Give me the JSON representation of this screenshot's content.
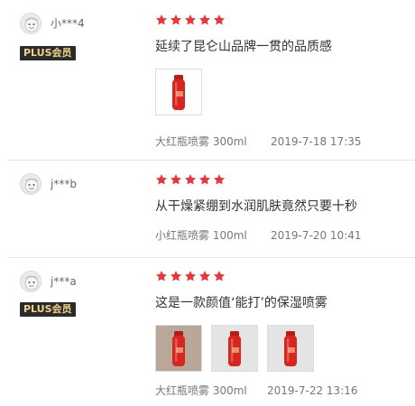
{
  "reviews": [
    {
      "username": "小***4",
      "badge": "PLUS会员",
      "rating": 5,
      "content": "延续了昆仑山品牌一贯的品质感",
      "product": "大红瓶喷雾 300ml",
      "date": "2019-7-18 17:35",
      "images": [
        "red-bottle-photo"
      ]
    },
    {
      "username": "j***b",
      "badge": "",
      "rating": 5,
      "content": "从干燥紧绷到水润肌肤竟然只要十秒",
      "product": "小红瓶喷雾 100ml",
      "date": "2019-7-20 10:41",
      "images": []
    },
    {
      "username": "j***a",
      "badge": "PLUS会员",
      "rating": 5,
      "content": "这是一款颜值‘能打’的保湿喷雾",
      "product": "大红瓶喷雾 300ml",
      "date": "2019-7-22 13:16",
      "images": [
        "red-bottle-photo",
        "red-bottle-photo",
        "red-bottle-photo"
      ]
    }
  ],
  "colors": {
    "star": "#e4393c",
    "badge_bg": "#2b2b2b",
    "badge_text": "#f2d28c",
    "bottle": "#d7261f"
  }
}
